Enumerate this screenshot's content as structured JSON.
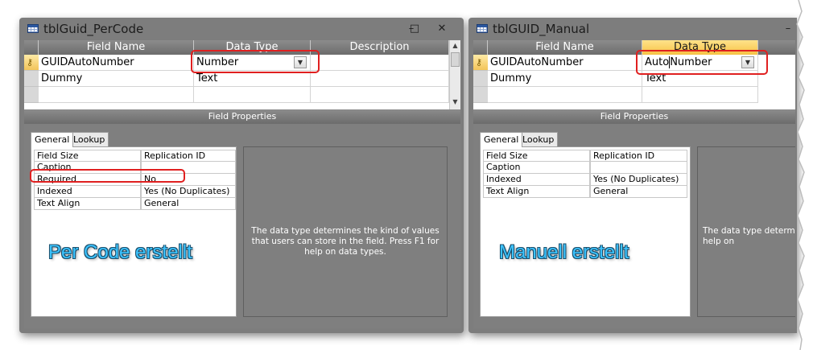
{
  "window1": {
    "title": "tblGuid_PerCode",
    "controls": {
      "minimize": "–",
      "maximize": "□",
      "close": "✕"
    },
    "columns": [
      "Field Name",
      "Data Type",
      "Description"
    ],
    "rows": [
      {
        "field": "GUIDAutoNumber",
        "type": "Number",
        "description": ""
      },
      {
        "field": "Dummy",
        "type": "Text",
        "description": ""
      }
    ],
    "field_properties_label": "Field Properties",
    "tabs": [
      "General",
      "Lookup"
    ],
    "properties": [
      {
        "name": "Field Size",
        "value": "Replication ID"
      },
      {
        "name": "Caption",
        "value": ""
      },
      {
        "name": "Required",
        "value": "No"
      },
      {
        "name": "Indexed",
        "value": "Yes (No Duplicates)"
      },
      {
        "name": "Text Align",
        "value": "General"
      }
    ],
    "help_text": "The data type determines the kind of values that users can store in the field. Press F1 for help on data types.",
    "annotation": "Per Code erstellt"
  },
  "window2": {
    "title": "tblGUID_Manual",
    "controls": {
      "minimize": "–"
    },
    "columns": [
      "Field Name",
      "Data Type"
    ],
    "rows": [
      {
        "field": "GUIDAutoNumber",
        "type_prefix": "Auto",
        "type": "Number"
      },
      {
        "field": "Dummy",
        "type": "Text"
      }
    ],
    "field_properties_label": "Field Properties",
    "tabs": [
      "General",
      "Lookup"
    ],
    "properties": [
      {
        "name": "Field Size",
        "value": "Replication ID"
      },
      {
        "name": "Caption",
        "value": ""
      },
      {
        "name": "Indexed",
        "value": "Yes (No Duplicates)"
      },
      {
        "name": "Text Align",
        "value": "General"
      }
    ],
    "help_text": "The data type determin that users can store i help on",
    "annotation": "Manuell erstellt"
  },
  "icons": [
    "table-icon",
    "key-icon",
    "dropdown-arrow-icon",
    "scroll-up-icon",
    "scroll-down-icon"
  ],
  "colors": {
    "highlight": "#e02020",
    "annotation": "#3cc4ff",
    "active_header": "#f6c244"
  }
}
